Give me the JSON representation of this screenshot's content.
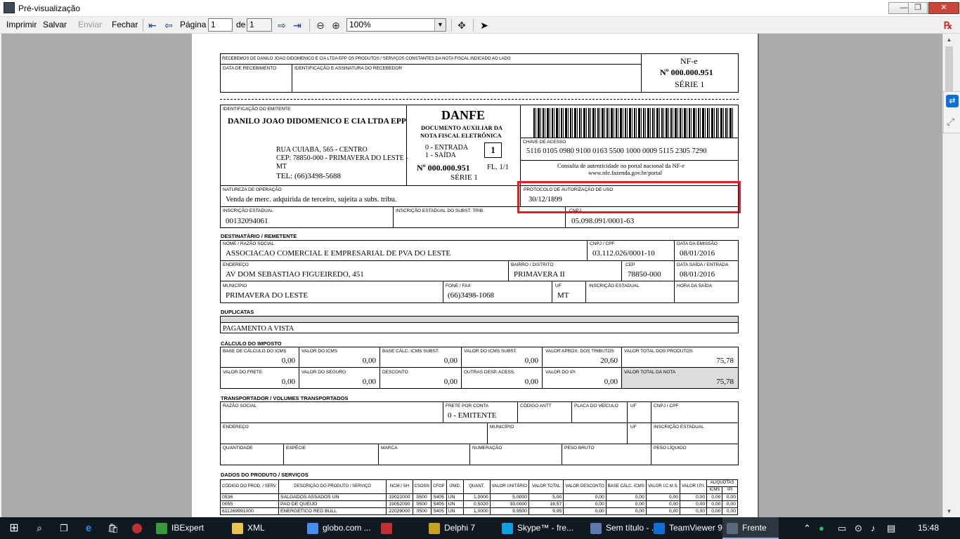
{
  "window": {
    "title": "Pré-visualização",
    "minimize": "—",
    "maximize": "❐",
    "close": "✕"
  },
  "toolbar": {
    "imprimir": "Imprimir",
    "salvar": "Salvar",
    "enviar": "Enviar",
    "fechar": "Fechar",
    "pagina_label": "Página",
    "page_value": "1",
    "de_label": "de",
    "page_total": "1",
    "zoom": "100%"
  },
  "danfe": {
    "canhoto_text": "RECEBEMOS DE DANILO JOAO DIDOMENICO E CIA LTDA EPP OS PRODUTOS / SERVIÇOS CONSTANTES DA NOTA FISCAL INDICADO AO LADO",
    "data_recebimento_label": "DATA DE RECEBIMENTO",
    "ident_assinatura_label": "IDENTIFICAÇÃO E ASSINATURA DO RECEBEDOR",
    "nfe_label": "NF-e",
    "nfe_numero": "Nº 000.000.951",
    "nfe_serie": "SÉRIE 1",
    "ident_emitente_label": "IDENTIFICAÇÃO DO EMITENTE",
    "emitente_nome": "DANILO JOAO DIDOMENICO E CIA LTDA EPP",
    "emitente_end1": "RUA CUIABA, 565 - CENTRO",
    "emitente_end2": "CEP: 78850-000 - PRIMAVERA DO LESTE -",
    "emitente_end3": "MT",
    "emitente_tel": "TEL: (66)3498-5688",
    "danfe_title": "DANFE",
    "danfe_sub1": "DOCUMENTO AUXILIAR DA",
    "danfe_sub2": "NOTA FISCAL ELETRÔNICA",
    "entrada": "0 - ENTRADA",
    "saida": "1 - SAÍDA",
    "tipo": "1",
    "danfe_numero": "Nº 000.000.951",
    "folha": "FL. 1/1",
    "danfe_serie": "SÉRIE 1",
    "chave_label": "CHAVE DE ACESSO",
    "chave": "5116 0105 0980 9100 0163 5500 1000 0009 5115 2305 7290",
    "consulta1": "Consulta de autenticidade no portal nacional da NF-e",
    "consulta2": "www.nfe.fazenda.gov.br/portal",
    "natureza_label": "NATUREZA DE OPERAÇÃO",
    "natureza": "Venda de merc. adquirida de terceiro, sujeita a subs. tribu.",
    "protocolo_label": "PROTOCOLO DE AUTORIZAÇÃO DE USO",
    "protocolo": "30/12/1899",
    "ie_label": "INSCRIÇÃO ESTADUAL",
    "ie": "00132094061",
    "ie_st_label": "INSCRIÇÃO ESTADUAL DO SUBST. TRIB.",
    "cnpj_label": "CNPJ",
    "cnpj": "05.098.091/0001-63",
    "dest_title": "DESTINATÁRIO / REMETENTE",
    "dest_nome_label": "NOME / RAZÃO SOCIAL",
    "dest_nome": "ASSOCIACAO COMERCIAL E EMPRESARIAL DE PVA DO LESTE",
    "dest_cnpj_label": "CNPJ / CPF",
    "dest_cnpj": "03.112.026/0001-10",
    "emissao_label": "DATA DA EMISSÃO",
    "emissao": "08/01/2016",
    "endereco_label": "ENDEREÇO",
    "endereco": "AV DOM SEBASTIAO FIGUEIREDO, 451",
    "bairro_label": "BAIRRO / DISTRITO",
    "bairro": "PRIMAVERA II",
    "cep_label": "CEP",
    "cep": "78850-000",
    "saida_label": "DATA SAÍDA / ENTRADA",
    "saida_data": "08/01/2016",
    "municipio_label": "MUNICÍPIO",
    "municipio": "PRIMAVERA DO LESTE",
    "fone_label": "FONE / FAX",
    "fone": "(66)3498-1068",
    "uf_label": "UF",
    "uf": "MT",
    "dest_ie_label": "INSCRIÇÃO ESTADUAL",
    "hora_label": "HORA DA SAÍDA",
    "dup_title": "DUPLICATAS",
    "dup_text": "PAGAMENTO A VISTA",
    "calc_title": "CÁLCULO DO IMPOSTO",
    "bc_icms_label": "BASE DE CÁLCULO DO ICMS",
    "bc_icms": "0,00",
    "v_icms_label": "VALOR DO ICMS",
    "v_icms": "0,00",
    "bc_st_label": "BASE CÁLC. ICMS SUBST.",
    "bc_st": "0,00",
    "v_st_label": "VALOR DO ICMS SUBST.",
    "v_st": "0,00",
    "v_trib_label": "VALOR APROX. DOS TRIBUTOS",
    "v_trib": "20,60",
    "v_prod_label": "VALOR TOTAL DOS PRODUTOS",
    "v_prod": "75,78",
    "frete_label": "VALOR DO FRETE",
    "frete": "0,00",
    "seguro_label": "VALOR DO SEGURO",
    "seguro": "0,00",
    "desc_label": "DESCONTO",
    "desc": "0,00",
    "outras_label": "OUTRAS DESP. ACESS.",
    "outras": "0,00",
    "ipi_label": "VALOR DO IPI",
    "ipi": "0,00",
    "v_nota_label": "VALOR TOTAL DA NOTA",
    "v_nota": "75,78",
    "transp_title": "TRANSPORTADOR / VOLUMES TRANSPORTADOS",
    "t_razao_label": "RAZÃO SOCIAL",
    "t_frete_label": "FRETE POR CONTA",
    "t_frete": "0 - EMITENTE",
    "t_antt_label": "CÓDIGO ANTT",
    "t_placa_label": "PLACA DO VEÍCULO",
    "t_uf_label": "UF",
    "t_cnpj_label": "CNPJ / CPF",
    "t_end_label": "ENDEREÇO",
    "t_mun_label": "MUNICÍPIO",
    "t_uf2_label": "UF",
    "t_ie_label": "INSCRIÇÃO ESTADUAL",
    "t_qtd_label": "QUANTIDADE",
    "t_esp_label": "ESPÉCIE",
    "t_marca_label": "MARCA",
    "t_num_label": "NUMERAÇÃO",
    "t_pb_label": "PESO BRUTO",
    "t_pl_label": "PESO LÍQUIDO",
    "prod_title": "DADOS DO PRODUTO / SERVIÇOS"
  },
  "products": {
    "headers": [
      "CÓDIGO DO PROD. / SERV.",
      "DESCRIÇÃO DO PRODUTO / SERVIÇO",
      "NCM / SH",
      "CSOSN",
      "CFOP",
      "UNID.",
      "QUANT.",
      "VALOR UNITÁRIO",
      "VALOR TOTAL",
      "VALOR DESCONTO",
      "BASE CÁLC. ICMS",
      "VALOR I.C.M.S.",
      "VALOR I.P.I.",
      "ALÍQUOTAS",
      "ICMS",
      "IPI"
    ],
    "rows": [
      [
        "0536",
        "SALGADOS ASSADOS UN",
        "19022000",
        "0500",
        "5405",
        "UN",
        "1,0000",
        "5,0000",
        "5,00",
        "0,00",
        "0,00",
        "0,00",
        "0,00",
        "0,00",
        "0,00"
      ],
      [
        "0055",
        "PAO DE QUEIJO",
        "19052090",
        "0500",
        "5405",
        "UN",
        "0,5020",
        "33,0000",
        "16,57",
        "0,00",
        "0,00",
        "0,00",
        "0,00",
        "0,00",
        "0,00"
      ],
      [
        "611269991000",
        "ENERGETICO RED BULL",
        "22029000",
        "0500",
        "5405",
        "UN",
        "1,0000",
        "9,9500",
        "9,95",
        "0,00",
        "0,00",
        "0,00",
        "0,00",
        "0,00",
        "0,00"
      ]
    ]
  },
  "taskbar": {
    "items": [
      {
        "label": "IBExpert",
        "color": "#3a9a3a"
      },
      {
        "label": "XML",
        "color": "#e8c44a"
      },
      {
        "label": "globo.com ...",
        "color": "#4a8df0"
      },
      {
        "label": "",
        "color": "#c03030"
      },
      {
        "label": "Delphi 7",
        "color": "#c8a020"
      },
      {
        "label": "Skype™ - fre...",
        "color": "#0ea0e0"
      },
      {
        "label": "Sem título - ...",
        "color": "#5a7ab0"
      },
      {
        "label": "TeamViewer 9",
        "color": "#0e6fd6"
      },
      {
        "label": "Frente",
        "color": "#5a6a7a"
      }
    ],
    "clock": "15:48"
  }
}
